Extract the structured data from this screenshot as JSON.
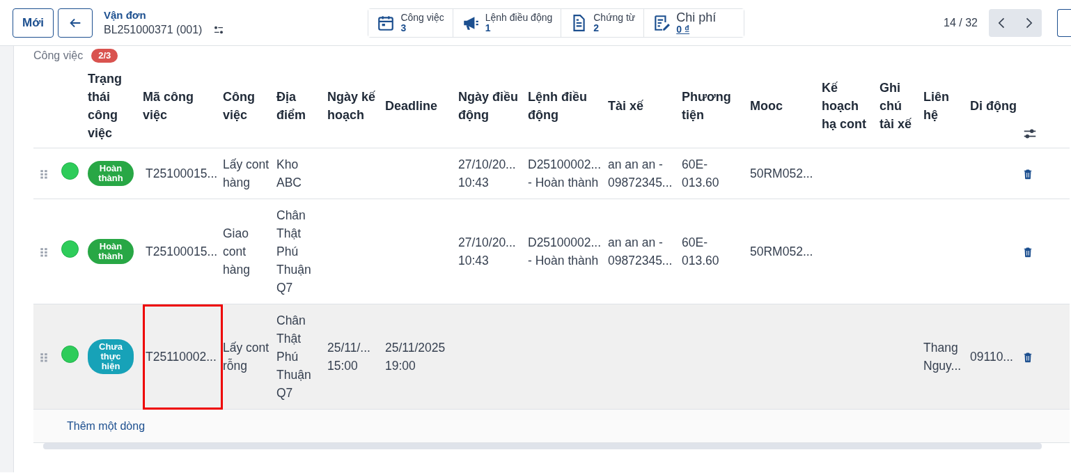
{
  "toolbar": {
    "new_button": "Mới",
    "breadcrumb": "Vận đơn",
    "record": "BL251000371 (001)",
    "stats": [
      {
        "kind": "calendar",
        "label": "Công việc",
        "value": "3"
      },
      {
        "kind": "megaphone",
        "label": "Lệnh điều động",
        "value": "1"
      },
      {
        "kind": "document",
        "label": "Chứng từ",
        "value": "2"
      },
      {
        "kind": "edit",
        "label": "Chi phí",
        "value": "0 ₫"
      }
    ],
    "pager": "14 / 32"
  },
  "section": {
    "title": "Công việc",
    "badge": "2/3"
  },
  "table": {
    "columns": [
      "Trạng thái công việc",
      "Mã công việc",
      "Công việc",
      "Địa điểm",
      "Ngày kế hoạch",
      "Deadline",
      "Ngày điều động",
      "Lệnh điều động",
      "Tài xế",
      "Phương tiện",
      "Mooc",
      "Kế hoạch hạ cont",
      "Ghi chú tài xế",
      "Liên hệ",
      "Di động"
    ],
    "rows": [
      {
        "selected": false,
        "outlined": false,
        "color": "#28a745",
        "cells": [
          "Hoàn thành",
          "T25100015...",
          "Lấy cont hàng",
          "Kho ABC",
          "",
          "",
          "27/10/20...\n10:43",
          "D25100002...\n- Hoàn thành",
          "an an an -\n09872345...",
          "60E-\n013.60",
          "50RM052...",
          "",
          "",
          "",
          ""
        ]
      },
      {
        "selected": false,
        "outlined": false,
        "color": "#28a745",
        "cells": [
          "Hoàn thành",
          "T25100015...",
          "Giao cont hàng",
          "Chân Thật Phú Thuận Q7",
          "",
          "",
          "27/10/20...\n10:43",
          "D25100002...\n- Hoàn thành",
          "an an an -\n09872345...",
          "60E-\n013.60",
          "50RM052...",
          "",
          "",
          "",
          ""
        ]
      },
      {
        "selected": true,
        "outlined": true,
        "color": "#17a2b8",
        "cells": [
          "Chưa thực hiện",
          "T25110002...",
          "Lấy cont rỗng",
          "Chân Thật Phú Thuận Q7",
          "25/11/...\n15:00",
          "25/11/2025\n19:00",
          "",
          "",
          "",
          "",
          "",
          "",
          "",
          "Thang\nNguy...",
          "09110..."
        ]
      }
    ],
    "add_line": "Thêm một dòng"
  }
}
